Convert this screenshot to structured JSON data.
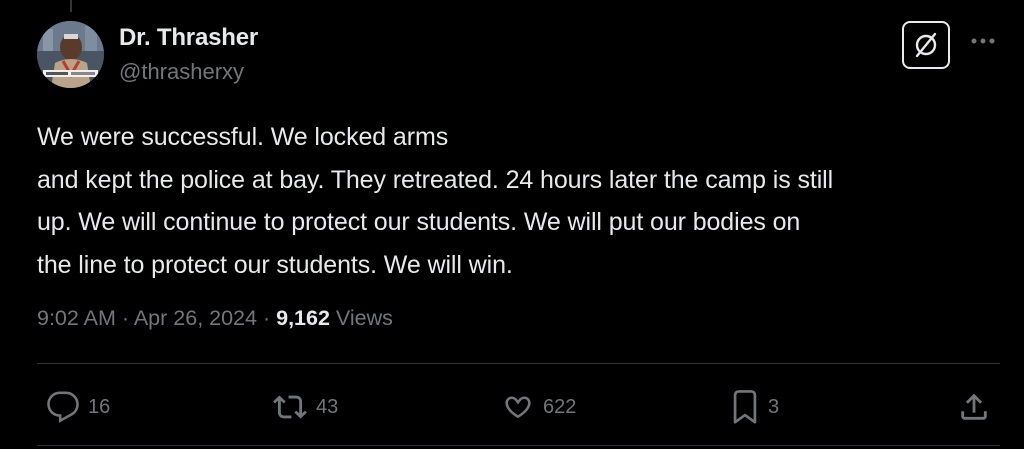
{
  "author": {
    "display_name": "Dr. Thrasher",
    "handle": "@thrasherxy"
  },
  "tweet": {
    "lines": [
      "We were successful. We locked arms",
      "and kept the police at bay. They retreated. 24 hours later the camp is still",
      "up. We will continue to protect our students. We will put our bodies on",
      "the line to protect our students. We will win."
    ],
    "time": "9:02 AM",
    "separator": "·",
    "date": "Apr 26, 2024",
    "views_count": "9,162",
    "views_label": "Views"
  },
  "actions": {
    "replies": "16",
    "reposts": "43",
    "likes": "622",
    "bookmarks": "3"
  },
  "icons": {
    "grok": "grok-icon",
    "more": "more-dots-icon",
    "reply": "reply-icon",
    "repost": "repost-icon",
    "like": "heart-icon",
    "bookmark": "bookmark-icon",
    "share": "share-icon"
  },
  "colors": {
    "background": "#000000",
    "text_primary": "#e7e9ea",
    "text_secondary": "#71767b",
    "divider": "#2f3336"
  }
}
